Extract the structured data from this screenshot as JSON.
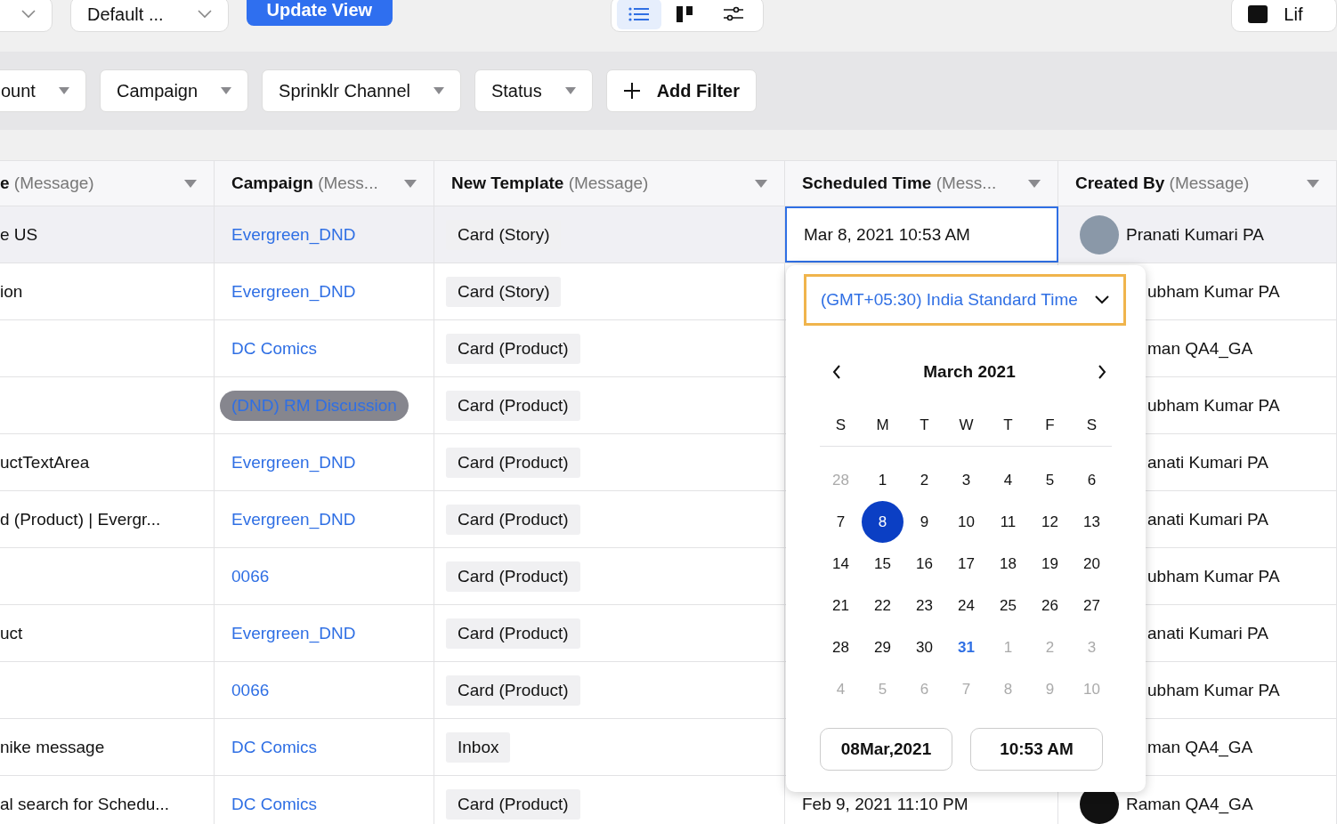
{
  "top_bar": {
    "dropdowns": [
      {
        "label": "Default ..."
      }
    ],
    "update_button": "Update View",
    "view_toggles": [
      {
        "kind": "list",
        "selected": true
      },
      {
        "kind": "board",
        "selected": false
      },
      {
        "kind": "settings",
        "selected": false
      }
    ],
    "right_button": "Lif"
  },
  "filters": [
    {
      "label": "ount"
    },
    {
      "label": "Campaign"
    },
    {
      "label": "Sprinklr Channel"
    },
    {
      "label": "Status"
    }
  ],
  "add_filter": "Add Filter",
  "table": {
    "columns": [
      {
        "title": "e",
        "qualifier": "(Message)"
      },
      {
        "title": "Campaign",
        "qualifier": "(Mess..."
      },
      {
        "title": "New Template",
        "qualifier": "(Message)"
      },
      {
        "title": "Scheduled Time",
        "qualifier": "(Mess..."
      },
      {
        "title": "Created By",
        "qualifier": "(Message)"
      }
    ],
    "rows": [
      {
        "name": "e US",
        "campaign": "Evergreen_DND",
        "campaign_highlighted": false,
        "template": "Card (Story)",
        "scheduled": "Mar 8, 2021 10:53 AM",
        "editing": true,
        "hovered": true,
        "created_by": "Pranati Kumari PA",
        "kind": "photo"
      },
      {
        "name": "ion",
        "campaign": "Evergreen_DND",
        "campaign_highlighted": false,
        "template": "Card (Story)",
        "editing": false,
        "hovered": false,
        "created_by": "ubham Kumar PA",
        "kind": "covered"
      },
      {
        "campaign": "DC Comics",
        "campaign_highlighted": false,
        "template": "Card (Product)",
        "editing": false,
        "hovered": false,
        "created_by": "man QA4_GA",
        "kind": "covered"
      },
      {
        "campaign": "(DND) RM Discussion",
        "campaign_highlighted": true,
        "template": "Card (Product)",
        "editing": false,
        "hovered": false,
        "created_by": "ubham Kumar PA",
        "kind": "covered"
      },
      {
        "name": "uctTextArea",
        "campaign": "Evergreen_DND",
        "campaign_highlighted": false,
        "template": "Card (Product)",
        "editing": false,
        "hovered": false,
        "created_by": "anati Kumari PA",
        "kind": "covered"
      },
      {
        "name": "d (Product) | Evergr...",
        "campaign": "Evergreen_DND",
        "campaign_highlighted": false,
        "template": "Card (Product)",
        "editing": false,
        "hovered": false,
        "created_by": "anati Kumari PA",
        "kind": "covered"
      },
      {
        "campaign": "0066",
        "campaign_highlighted": false,
        "template": "Card (Product)",
        "editing": false,
        "hovered": false,
        "created_by": "ubham Kumar PA",
        "kind": "covered"
      },
      {
        "name": "uct",
        "campaign": "Evergreen_DND",
        "campaign_highlighted": false,
        "template": "Card (Product)",
        "editing": false,
        "hovered": false,
        "created_by": "anati Kumari PA",
        "kind": "covered"
      },
      {
        "campaign": "0066",
        "campaign_highlighted": false,
        "template": "Card (Product)",
        "editing": false,
        "hovered": false,
        "created_by": "ubham Kumar PA",
        "kind": "covered"
      },
      {
        "name": "nike message",
        "campaign": "DC Comics",
        "campaign_highlighted": false,
        "template": "Inbox",
        "editing": false,
        "hovered": false,
        "created_by": "man QA4_GA",
        "kind": "covered"
      },
      {
        "name": "al search for Schedu...",
        "campaign": "DC Comics",
        "campaign_highlighted": false,
        "template": "Card (Product)",
        "scheduled": "Feb 9, 2021 11:10 PM",
        "editing": false,
        "hovered": false,
        "created_by": "Raman QA4_GA",
        "kind": "dark"
      }
    ]
  },
  "date_picker": {
    "timezone": "(GMT+05:30) India Standard Time",
    "month": "March 2021",
    "weekdays": [
      "S",
      "M",
      "T",
      "W",
      "T",
      "F",
      "S"
    ],
    "weeks": [
      [
        {
          "label": "28",
          "outside": true,
          "selected": false,
          "today": false
        },
        {
          "label": "1",
          "outside": false,
          "selected": false,
          "today": false
        },
        {
          "label": "2",
          "outside": false,
          "selected": false,
          "today": false
        },
        {
          "label": "3",
          "outside": false,
          "selected": false,
          "today": false
        },
        {
          "label": "4",
          "outside": false,
          "selected": false,
          "today": false
        },
        {
          "label": "5",
          "outside": false,
          "selected": false,
          "today": false
        },
        {
          "label": "6",
          "outside": false,
          "selected": false,
          "today": false
        }
      ],
      [
        {
          "label": "7",
          "outside": false,
          "selected": false,
          "today": false
        },
        {
          "label": "8",
          "outside": false,
          "selected": true,
          "today": false
        },
        {
          "label": "9",
          "outside": false,
          "selected": false,
          "today": false
        },
        {
          "label": "10",
          "outside": false,
          "selected": false,
          "today": false
        },
        {
          "label": "11",
          "outside": false,
          "selected": false,
          "today": false
        },
        {
          "label": "12",
          "outside": false,
          "selected": false,
          "today": false
        },
        {
          "label": "13",
          "outside": false,
          "selected": false,
          "today": false
        }
      ],
      [
        {
          "label": "14",
          "outside": false,
          "selected": false,
          "today": false
        },
        {
          "label": "15",
          "outside": false,
          "selected": false,
          "today": false
        },
        {
          "label": "16",
          "outside": false,
          "selected": false,
          "today": false
        },
        {
          "label": "17",
          "outside": false,
          "selected": false,
          "today": false
        },
        {
          "label": "18",
          "outside": false,
          "selected": false,
          "today": false
        },
        {
          "label": "19",
          "outside": false,
          "selected": false,
          "today": false
        },
        {
          "label": "20",
          "outside": false,
          "selected": false,
          "today": false
        }
      ],
      [
        {
          "label": "21",
          "outside": false,
          "selected": false,
          "today": false
        },
        {
          "label": "22",
          "outside": false,
          "selected": false,
          "today": false
        },
        {
          "label": "23",
          "outside": false,
          "selected": false,
          "today": false
        },
        {
          "label": "24",
          "outside": false,
          "selected": false,
          "today": false
        },
        {
          "label": "25",
          "outside": false,
          "selected": false,
          "today": false
        },
        {
          "label": "26",
          "outside": false,
          "selected": false,
          "today": false
        },
        {
          "label": "27",
          "outside": false,
          "selected": false,
          "today": false
        }
      ],
      [
        {
          "label": "28",
          "outside": false,
          "selected": false,
          "today": false
        },
        {
          "label": "29",
          "outside": false,
          "selected": false,
          "today": false
        },
        {
          "label": "30",
          "outside": false,
          "selected": false,
          "today": false
        },
        {
          "label": "31",
          "outside": false,
          "selected": false,
          "today": true
        },
        {
          "label": "1",
          "outside": true,
          "selected": false,
          "today": false
        },
        {
          "label": "2",
          "outside": true,
          "selected": false,
          "today": false
        },
        {
          "label": "3",
          "outside": true,
          "selected": false,
          "today": false
        }
      ],
      [
        {
          "label": "4",
          "outside": true,
          "selected": false,
          "today": false
        },
        {
          "label": "5",
          "outside": true,
          "selected": false,
          "today": false
        },
        {
          "label": "6",
          "outside": true,
          "selected": false,
          "today": false
        },
        {
          "label": "7",
          "outside": true,
          "selected": false,
          "today": false
        },
        {
          "label": "8",
          "outside": true,
          "selected": false,
          "today": false
        },
        {
          "label": "9",
          "outside": true,
          "selected": false,
          "today": false
        },
        {
          "label": "10",
          "outside": true,
          "selected": false,
          "today": false
        }
      ]
    ],
    "date_field": "08Mar,2021",
    "time_field": "10:53 AM"
  }
}
